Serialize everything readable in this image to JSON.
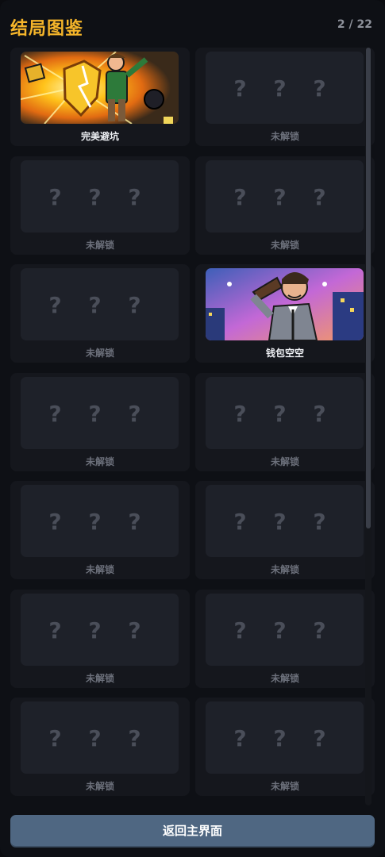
{
  "header": {
    "title": "结局图鉴",
    "counter": "2 / 22"
  },
  "colors": {
    "accent": "#f5b52a",
    "button": "#4f6782",
    "locked_text": "#6c707b"
  },
  "placeholder": "? ? ?",
  "endings": [
    {
      "label": "完美避坑",
      "unlocked": true,
      "art": "comic-hero-shield-explosion"
    },
    {
      "label": "未解锁",
      "unlocked": false
    },
    {
      "label": "未解锁",
      "unlocked": false
    },
    {
      "label": "未解锁",
      "unlocked": false
    },
    {
      "label": "未解锁",
      "unlocked": false
    },
    {
      "label": "钱包空空",
      "unlocked": true,
      "art": "comic-man-empty-wallet"
    },
    {
      "label": "未解锁",
      "unlocked": false
    },
    {
      "label": "未解锁",
      "unlocked": false
    },
    {
      "label": "未解锁",
      "unlocked": false
    },
    {
      "label": "未解锁",
      "unlocked": false
    },
    {
      "label": "未解锁",
      "unlocked": false
    },
    {
      "label": "未解锁",
      "unlocked": false
    },
    {
      "label": "未解锁",
      "unlocked": false
    },
    {
      "label": "未解锁",
      "unlocked": false
    }
  ],
  "footer": {
    "back_label": "返回主界面"
  }
}
